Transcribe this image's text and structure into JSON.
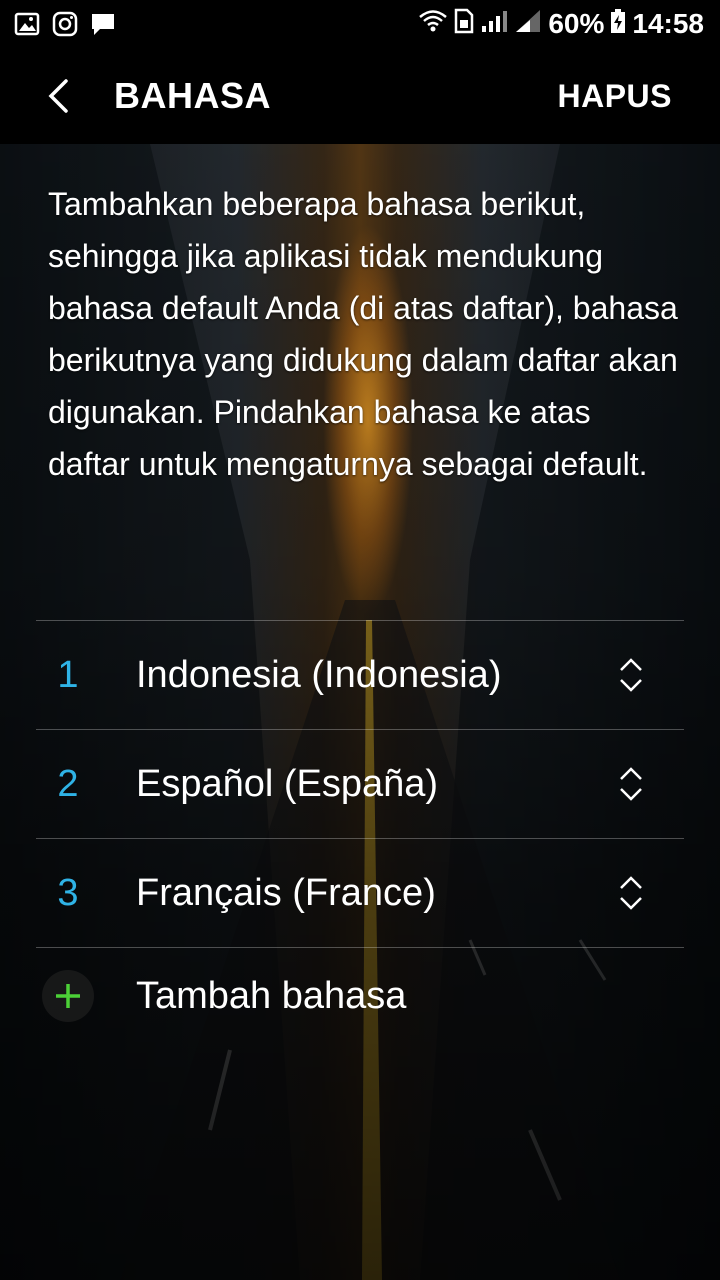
{
  "status_bar": {
    "left_icons": [
      "image-icon",
      "instagram-icon",
      "message-icon"
    ],
    "right_icons": [
      "wifi-icon",
      "sim-icon",
      "signal-icon",
      "signal-icon",
      "battery-icon"
    ],
    "battery": "60%",
    "time": "14:58"
  },
  "appbar": {
    "back_icon": "chevron-left-icon",
    "title": "BAHASA",
    "action": "HAPUS"
  },
  "description": "Tambahkan beberapa bahasa berikut, sehingga jika aplikasi tidak mendukung bahasa default Anda (di atas daftar), bahasa berikutnya yang didukung dalam daftar akan digunakan. Pindahkan bahasa ke atas daftar untuk mengaturnya sebagai default.",
  "languages": [
    {
      "index": "1",
      "name": "Indonesia (Indonesia)"
    },
    {
      "index": "2",
      "name": "Español (España)"
    },
    {
      "index": "3",
      "name": "Français (France)"
    }
  ],
  "add_language": {
    "icon": "plus-icon",
    "label": "Tambah bahasa"
  },
  "colors": {
    "accent": "#2fb3e6",
    "add_icon": "#4cd137",
    "bars": "#000000"
  }
}
